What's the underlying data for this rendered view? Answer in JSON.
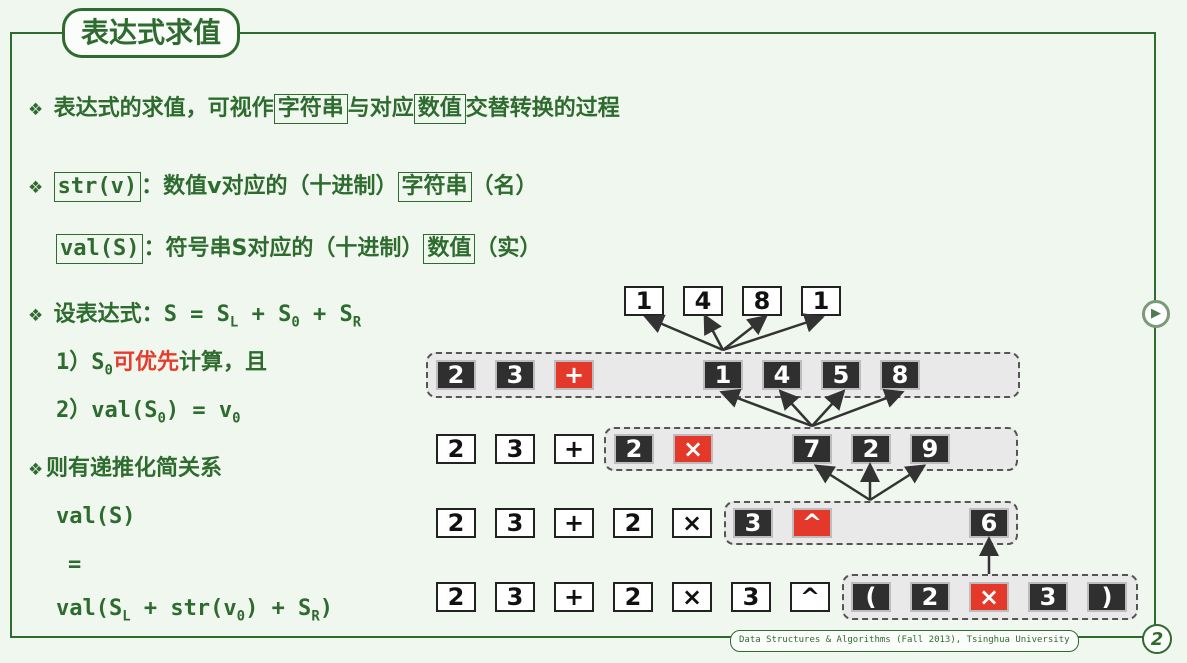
{
  "title": "表达式求值",
  "line1": {
    "bullet": "❖",
    "pre": "表达式的求值，可视作",
    "box1": "字符串",
    "mid": "与对应",
    "box2": "数值",
    "post": "交替转换的过程"
  },
  "line2": {
    "bullet": "❖",
    "func": "str(v)",
    "pre": "：数值v对应的（十进制）",
    "box": "字符串",
    "post": "（名）"
  },
  "line3": {
    "func": "val(S)",
    "pre": "：符号串S对应的（十进制）",
    "box": "数值",
    "post": "（实）"
  },
  "line4": {
    "bullet": "❖",
    "pre": "设表达式：",
    "expr_s": "S = S",
    "sub_l": "L",
    "plus1": " + S",
    "sub_0": "0",
    "plus2": " + S",
    "sub_r": "R"
  },
  "line5": {
    "num": "1）S",
    "sub": "0",
    "red": "可优先",
    "post": "计算，且"
  },
  "line6": {
    "num": "2）val(S",
    "sub": "0",
    "mid": ") = v",
    "sub2": "0"
  },
  "line7": {
    "bullet": "❖",
    "text": "则有递推化简关系"
  },
  "line8": {
    "text": "val(S)"
  },
  "line9": {
    "text": "="
  },
  "line10": {
    "a": "val(S",
    "sub_l": "L",
    "b": " + str(v",
    "sub_0": "0",
    "c": ") + S",
    "sub_r": "R",
    "d": ")"
  },
  "rows": {
    "top": [
      "1",
      "4",
      "8",
      "1"
    ],
    "r1": [
      "2",
      "3",
      "+",
      "1",
      "4",
      "5",
      "8"
    ],
    "r2": [
      "2",
      "3",
      "+",
      "2",
      "×",
      "7",
      "2",
      "9"
    ],
    "r3": [
      "2",
      "3",
      "+",
      "2",
      "×",
      "3",
      "^",
      "6"
    ],
    "r4": [
      "2",
      "3",
      "+",
      "2",
      "×",
      "3",
      "^",
      "(",
      "2",
      "×",
      "3",
      ")"
    ]
  },
  "footer": "Data Structures & Algorithms (Fall 2013), Tsinghua University",
  "page_number": "2",
  "next_icon": "▶",
  "colors": {
    "text": "#2e6b2e",
    "highlight": "#e53c2c",
    "token_dark": "#2f2f2f"
  }
}
